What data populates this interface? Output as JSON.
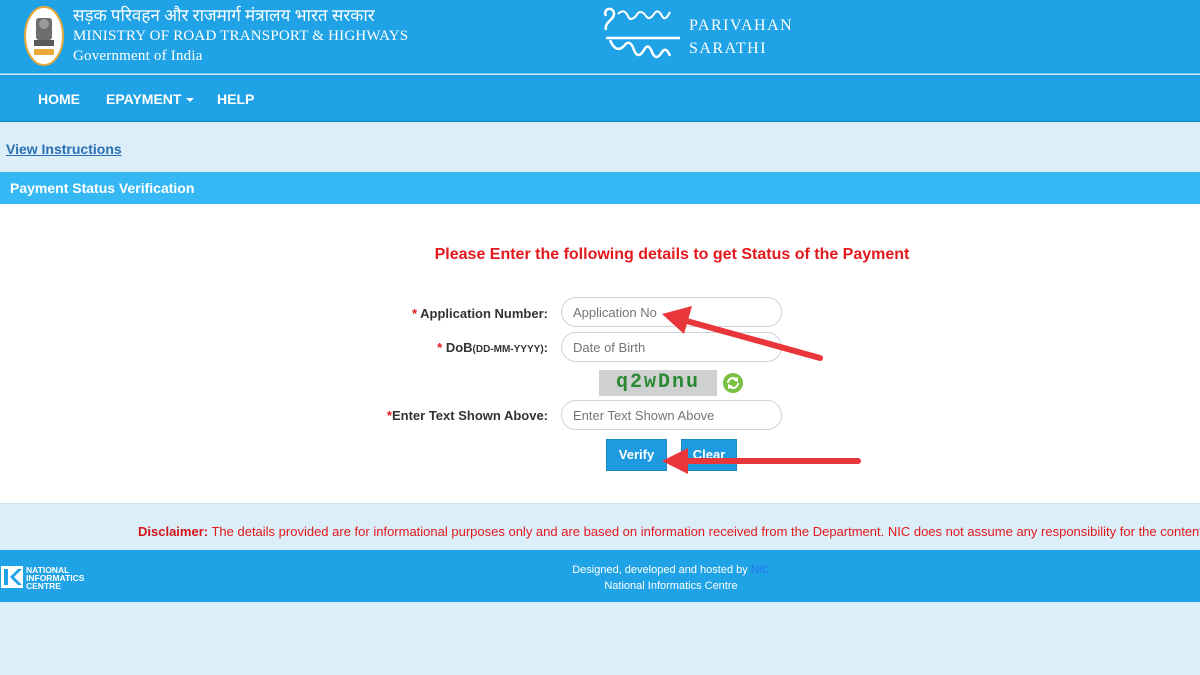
{
  "header": {
    "ministry_hindi": "सड़क परिवहन और राजमार्ग मंत्रालय भारत सरकार",
    "ministry_english": "MINISTRY OF ROAD TRANSPORT & HIGHWAYS",
    "government": "Government of India",
    "brand_line1": "PARIVAHAN",
    "brand_line2": "SARATHI"
  },
  "nav": {
    "home": "HOME",
    "epayment": "EPAYMENT",
    "help": "HELP"
  },
  "view_instructions": "View Instructions",
  "section_title": "Payment Status Verification",
  "form": {
    "heading": "Please Enter the following details to get Status of the Payment",
    "application_label": "Application Number:",
    "application_placeholder": "Application No",
    "dob_label": "DoB",
    "dob_format": "(DD-MM-YYYY)",
    "dob_colon": ":",
    "dob_placeholder": "Date of Birth",
    "captcha_text": "q2wDnu",
    "captcha_label": "Enter Text Shown Above:",
    "captcha_placeholder": "Enter Text Shown Above",
    "required_mark": "*",
    "verify_label": "Verify",
    "clear_label": "Clear"
  },
  "disclaimer": {
    "prefix": "Disclaimer:",
    "text": " The details provided are for informational purposes only and are based on information received from the Department. NIC does not assume any responsibility for the content"
  },
  "footer": {
    "designed_by": "Designed, developed and hosted by",
    "nic_link": "NIC",
    "org": "National Informatics Centre",
    "nic_logo_line1": "NATIONAL",
    "nic_logo_line2": "INFORMATICS",
    "nic_logo_line3": "CENTRE"
  },
  "colors": {
    "header_blue": "#1fa3e6",
    "section_blue": "#36b8f5",
    "heading_red": "#e3181d",
    "button_blue": "#1d9ae0",
    "arrow_red": "#e8363a"
  },
  "icons": [
    "emblem-icon",
    "sarathi-logo-icon",
    "caret-down-icon",
    "refresh-captcha-icon",
    "nic-logo-icon",
    "arrow-annotation"
  ]
}
